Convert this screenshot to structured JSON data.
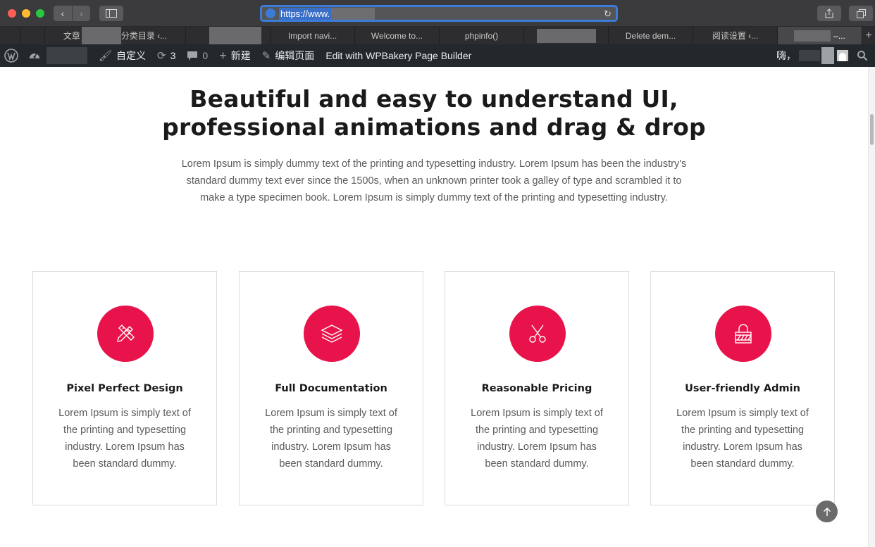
{
  "browser": {
    "url": "https://www.",
    "tabs": [
      {
        "label": "",
        "active": false
      },
      {
        "label": "文章",
        "active": false,
        "suffix": "分类目录 ‹..."
      },
      {
        "label": "",
        "active": false
      },
      {
        "label": "Import navi...",
        "active": false
      },
      {
        "label": "Welcome to...",
        "active": false
      },
      {
        "label": "phpinfo()",
        "active": false
      },
      {
        "label": "",
        "active": false
      },
      {
        "label": "Delete dem...",
        "active": false
      },
      {
        "label": "阅读设置 ‹...",
        "active": false
      },
      {
        "label": "–...",
        "active": true
      }
    ]
  },
  "adminbar": {
    "customize": "自定义",
    "updates_count": "3",
    "comments_count": "0",
    "new": "新建",
    "edit_page": "编辑页面",
    "wpbakery": "Edit with WPBakery Page Builder",
    "greeting": "嗨，"
  },
  "hero": {
    "title_line1": "Beautiful and easy to understand UI,",
    "title_line2": "professional animations and drag & drop",
    "text": "Lorem Ipsum is simply dummy text of the printing and typesetting industry. Lorem Ipsum has been the industry's standard dummy text ever since the 1500s, when an unknown printer took a galley of type and scrambled it to make a type specimen book. Lorem Ipsum is simply dummy text of the printing and typesetting industry."
  },
  "features": [
    {
      "icon": "pencil-ruler-icon",
      "title": "Pixel Perfect Design",
      "text": "Lorem Ipsum is simply text of the printing and typesetting industry. Lorem Ipsum has been standard dummy."
    },
    {
      "icon": "layers-icon",
      "title": "Full Documentation",
      "text": "Lorem Ipsum is simply text of the printing and typesetting industry. Lorem Ipsum has been standard dummy."
    },
    {
      "icon": "scissors-icon",
      "title": "Reasonable Pricing",
      "text": "Lorem Ipsum is simply text of the printing and typesetting industry. Lorem Ipsum has been standard dummy."
    },
    {
      "icon": "lock-icon",
      "title": "User-friendly Admin",
      "text": "Lorem Ipsum is simply text of the printing and typesetting industry. Lorem Ipsum has been standard dummy."
    }
  ],
  "colors": {
    "accent": "#e8134a",
    "adminbar": "#23282d"
  }
}
